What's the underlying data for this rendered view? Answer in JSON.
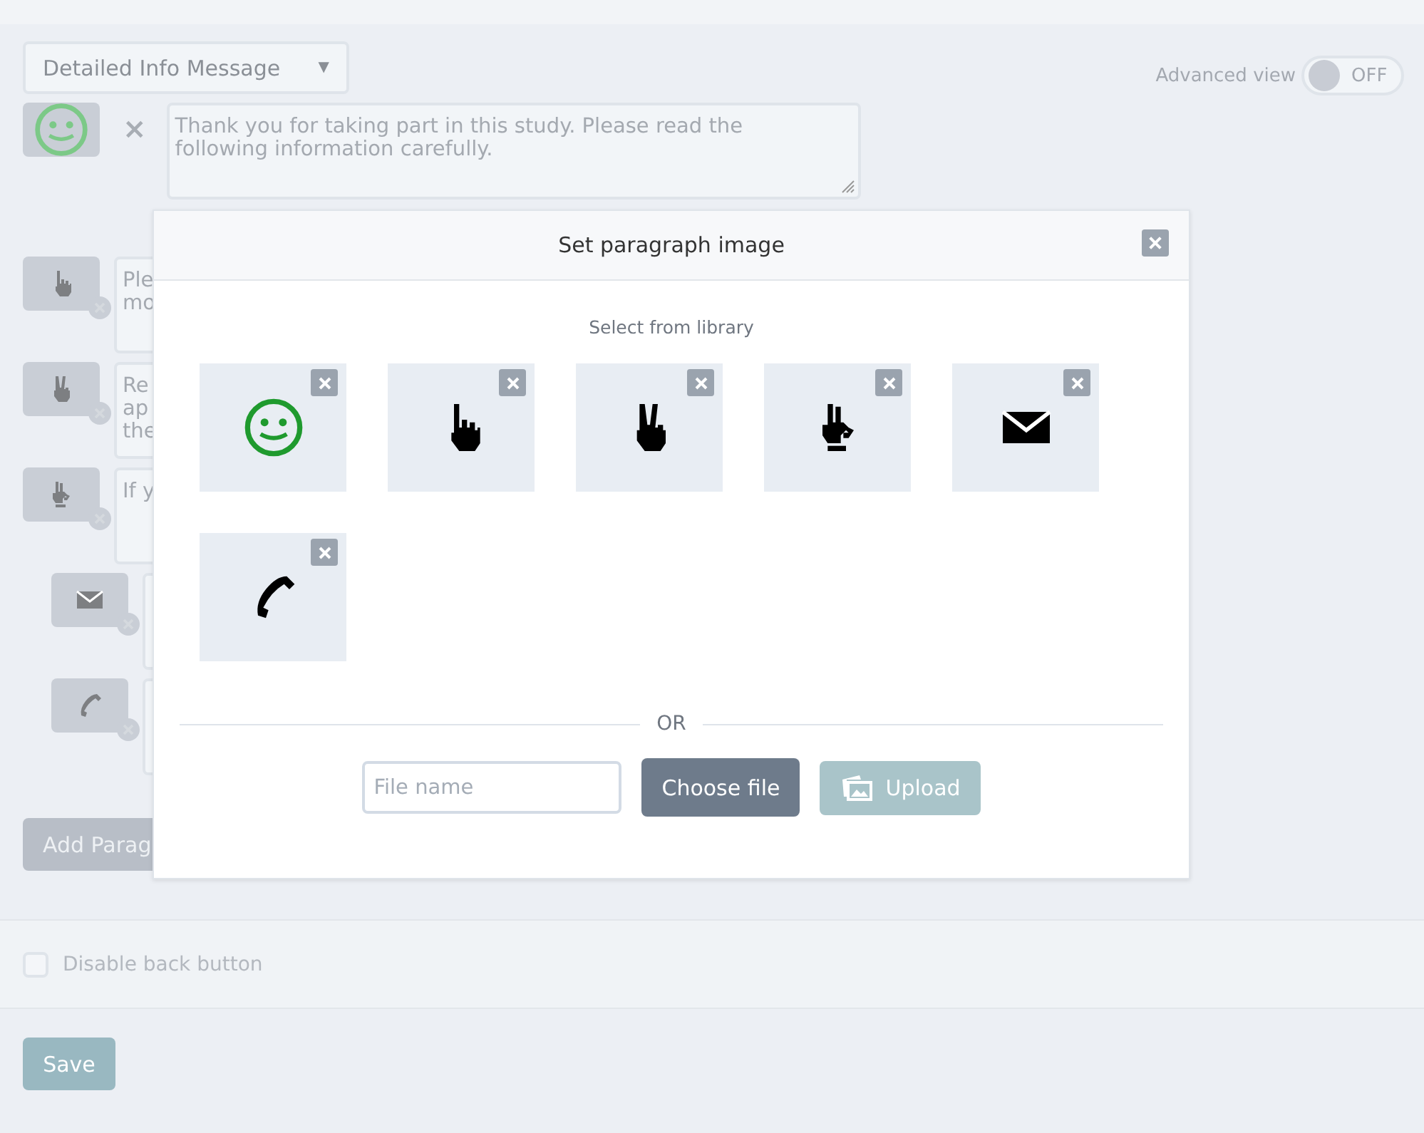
{
  "message_type": {
    "value": "Detailed Info Message",
    "caret": "▼"
  },
  "advanced_view": {
    "label": "Advanced view",
    "on": false,
    "state_text": "OFF"
  },
  "paragraphs": [
    {
      "kind": "smiley",
      "lines": [
        "Thank you for taking part in this study. Please read the",
        "following information carefully."
      ],
      "remove": "×"
    },
    {
      "kind": "point",
      "lines": [
        "Ple",
        "mo"
      ]
    },
    {
      "kind": "peace",
      "lines": [
        "Re",
        "ap",
        "the"
      ]
    },
    {
      "kind": "ok",
      "lines": [
        "If y"
      ],
      "children": [
        {
          "kind": "mail"
        },
        {
          "kind": "phone"
        }
      ]
    }
  ],
  "add_paragraph": "Add Parag",
  "disable_back": {
    "label": "Disable back button",
    "checked": false
  },
  "save": "Save",
  "dialog": {
    "title": "Set paragraph image",
    "subtitle": "Select from library",
    "library": [
      {
        "kind": "smiley"
      },
      {
        "kind": "point"
      },
      {
        "kind": "peace"
      },
      {
        "kind": "ok"
      },
      {
        "kind": "mail"
      },
      {
        "kind": "phone"
      }
    ],
    "separator": "OR",
    "file_field": {
      "placeholder": "File name"
    },
    "choose": "Choose file",
    "upload": {
      "label": "Upload",
      "disabled": true
    }
  }
}
